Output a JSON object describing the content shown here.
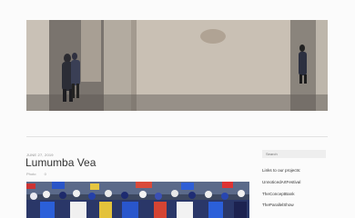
{
  "post": {
    "date": "JUNE 27, 2019",
    "title": "Lumumba Vea",
    "meta": [
      "Photo",
      "0"
    ]
  },
  "sidebar": {
    "search_placeholder": "Search",
    "heading": "Links to our projects:",
    "links": [
      "UnnoticedArtFestival",
      "TheConceptBank",
      "TheParallelShow"
    ]
  },
  "colors": {
    "background": "#fbfbfb",
    "text": "#333333",
    "muted": "#8a8a8a"
  }
}
